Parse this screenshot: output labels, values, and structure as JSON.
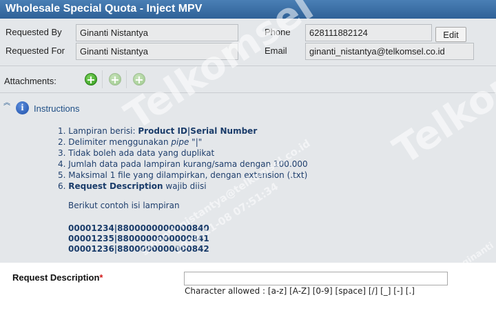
{
  "window": {
    "title": "Wholesale Special Quota - Inject MPV"
  },
  "requester": {
    "requested_by_label": "Requested By",
    "requested_by_value": "Ginanti Nistantya",
    "requested_for_label": "Requested For",
    "requested_for_value": "Ginanti Nistantya",
    "phone_label": "Phone",
    "phone_value": "628111882124",
    "email_label": "Email",
    "email_value": "ginanti_nistantya@telkomsel.co.id",
    "edit_label": "Edit"
  },
  "attachments": {
    "label": "Attachments:",
    "buttons": [
      {
        "icon": "add-icon",
        "state": "enabled"
      },
      {
        "icon": "add-icon",
        "state": "disabled"
      },
      {
        "icon": "add-icon",
        "state": "disabled"
      }
    ]
  },
  "instructions": {
    "title": "Instructions",
    "items": [
      {
        "prefix": "1. Lampiran berisi: ",
        "bold": "Product ID|Serial Number",
        "suffix": ""
      },
      {
        "prefix": "2. Delimiter menggunakan ",
        "italic": "pipe",
        "suffix": " \"|\""
      },
      {
        "prefix": "3. Tidak boleh ada data yang duplikat"
      },
      {
        "prefix": "4. Jumlah data pada lampiran kurang/sama dengan 100.000"
      },
      {
        "prefix": "5. Maksimal 1 file yang dilampirkan, dengan extension (.txt)"
      },
      {
        "prefix": "6. ",
        "bold": "Request Description",
        "suffix": " wajib diisi"
      }
    ],
    "example_intro": "Berikut contoh isi lampiran",
    "example_lines": [
      "00001234|8800000000000840",
      "00001235|8800000000000841",
      "00001236|8800000000000842"
    ]
  },
  "request_description": {
    "label": "Request Description",
    "required_mark": "*",
    "value": "",
    "hint": "Character allowed : [a-z] [A-Z] [0-9] [space] [/] [_] [-] [.]"
  },
  "watermark": {
    "brand": "Telkomsel",
    "lines": [
      "ginanti_nistantya@telkomsel.co.id",
      "2024-11-08 07:51:34",
      "ginanti"
    ]
  },
  "colors": {
    "title_bar": "#3a6ea5",
    "panel": "#e4e7ea",
    "instruction_text": "#1f3f6d",
    "required": "#d21a1a"
  }
}
